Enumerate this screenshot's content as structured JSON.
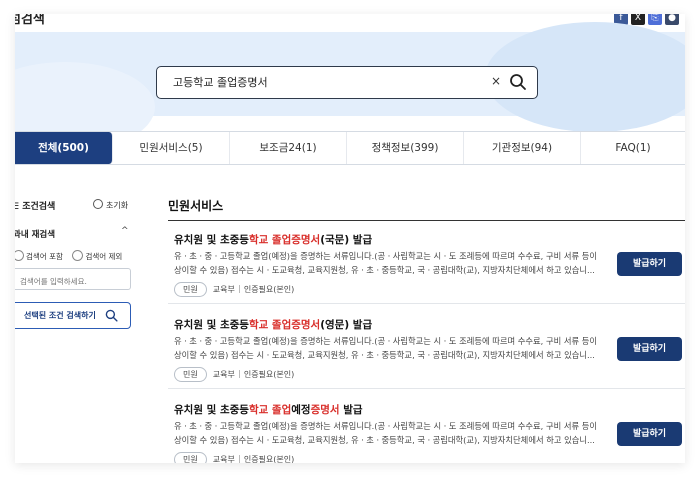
{
  "site_title": "섬검색",
  "sns": [
    {
      "icon": "facebook-icon",
      "glyph": "f",
      "color": "#3b5998"
    },
    {
      "icon": "x-icon",
      "glyph": "X",
      "color": "#222222"
    },
    {
      "icon": "link-icon",
      "glyph": "⎘",
      "color": "#4f6fd8"
    },
    {
      "icon": "print-icon",
      "glyph": "●",
      "color": "#3a4a6b"
    }
  ],
  "search": {
    "value": "고등학교 졸업증명서",
    "clear": "×"
  },
  "tabs": [
    {
      "label": "전체(500)",
      "active": true
    },
    {
      "label": "민원서비스(5)"
    },
    {
      "label": "보조금24(1)"
    },
    {
      "label": "정책정보(399)"
    },
    {
      "label": "기관정보(94)"
    },
    {
      "label": "FAQ(1)"
    }
  ],
  "sidebar": {
    "condition": "조건검색",
    "reset": "초기화",
    "within_search": "과내 재검색",
    "chevron": "^",
    "radio_include": "검색어 포함",
    "radio_exclude": "검색어 제외",
    "keyword_placeholder": "검색어를 입력하세요.",
    "apply": "선택된 조건 검색하기"
  },
  "section_title": "민원서비스",
  "items": [
    {
      "title_pre": "유치원 및 초중등",
      "title_hl1": "학교 졸업증명서",
      "title_mid": "",
      "title_hl2": "",
      "title_post": "(국문) 발급",
      "desc1": "유ㆍ초ㆍ중ㆍ고등학교 졸업(예정)을 증명하는 서류입니다.(공ㆍ사립학교는 시ㆍ도 조례등에 따르며 수수료, 구비 서류 등이",
      "desc2": "상이할 수 있음) 접수는 시ㆍ도교육청, 교육지원청, 유ㆍ초ㆍ중등학교, 국ㆍ공립대학(교), 지방자치단체에서 하고 있습니...",
      "chip": "민원",
      "org": "교육부",
      "auth": "인증필요(본인)",
      "button": "발급하기"
    },
    {
      "title_pre": "유치원 및 초중등",
      "title_hl1": "학교 졸업증명서",
      "title_mid": "",
      "title_hl2": "",
      "title_post": "(영문) 발급",
      "desc1": "유ㆍ초ㆍ중ㆍ고등학교 졸업(예정)을 증명하는 서류입니다.(공ㆍ사립학교는 시ㆍ도 조례등에 따르며 수수료, 구비 서류 등이",
      "desc2": "상이할 수 있음) 접수는 시ㆍ도교육청, 교육지원청, 유ㆍ초ㆍ중등학교, 국ㆍ공립대학(교), 지방자치단체에서 하고 있습니...",
      "chip": "민원",
      "org": "교육부",
      "auth": "인증필요(본인)",
      "button": "발급하기"
    },
    {
      "title_pre": "유치원 및 초중등",
      "title_hl1": "학교 졸업",
      "title_mid": "예정",
      "title_hl2": "증명서",
      "title_post": " 발급",
      "desc1": "유ㆍ초ㆍ중ㆍ고등학교 졸업(예정)을 증명하는 서류입니다.(공ㆍ사립학교는 시ㆍ도 조례등에 따르며 수수료, 구비 서류 등이",
      "desc2": "상이할 수 있음) 접수는 시ㆍ도교육청, 교육지원청, 유ㆍ초ㆍ중등학교, 국ㆍ공립대학(교), 지방자치단체에서 하고 있습니...",
      "chip": "민원",
      "org": "교육부",
      "auth": "인증필요(본인)",
      "button": "발급하기"
    }
  ]
}
